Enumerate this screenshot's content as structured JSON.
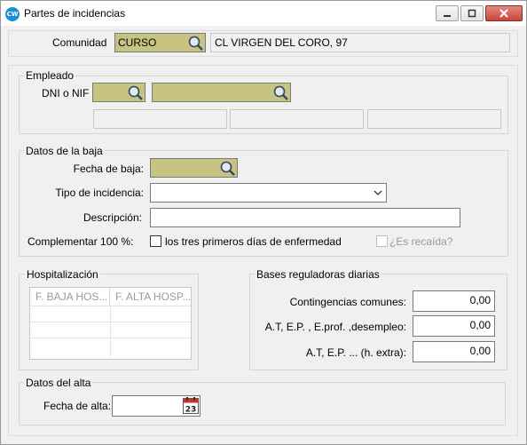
{
  "window": {
    "title": "Partes de incidencias",
    "icon_text": "CW"
  },
  "community": {
    "label": "Comunidad",
    "code": "CURSO",
    "name": "CL VIRGEN DEL CORO, 97"
  },
  "employee": {
    "title": "Empleado",
    "nif_label": "DNI o NIF",
    "nif_value": "",
    "name_value": ""
  },
  "leave": {
    "title": "Datos de la baja",
    "date_label": "Fecha de baja:",
    "type_label": "Tipo de incidencia:",
    "type_value": "",
    "description_label": "Descripción:",
    "description_value": "",
    "complement_label": "Complementar 100 %:",
    "first_three_days_label": "los tres primeros días de enfermedad",
    "relapse_label": "¿Es recaída?"
  },
  "hospital": {
    "title": "Hospitalización",
    "columns": [
      "F. BAJA HOS...",
      "F. ALTA HOSP..."
    ]
  },
  "bases": {
    "title": "Bases reguladoras diarias",
    "rows": [
      {
        "label": "Contingencias comunes:",
        "value": "0,00"
      },
      {
        "label": "A.T,  E.P. , E.prof. ,desempleo:",
        "value": "0,00"
      },
      {
        "label": "A.T,  E.P. ... (h. extra):",
        "value": "0,00"
      }
    ]
  },
  "discharge": {
    "title": "Datos del alta",
    "date_label": "Fecha de alta:",
    "date_value": "",
    "calendar_day": "23"
  },
  "colors": {
    "lookup_fill": "#c7c382",
    "title_close": "#c7463a"
  }
}
